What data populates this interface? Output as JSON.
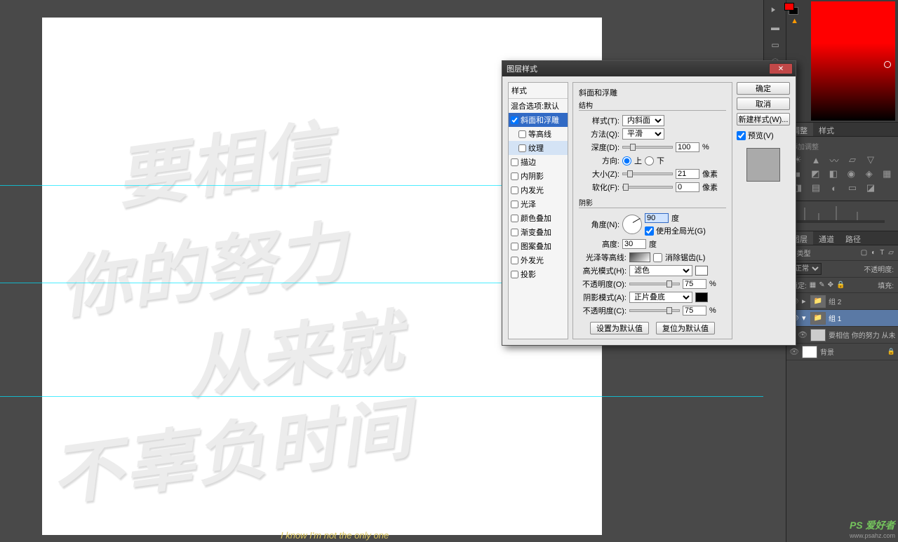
{
  "canvas": {
    "lines": [
      "要相信",
      "你的努力",
      "从来就",
      "不辜负时间"
    ]
  },
  "dialog": {
    "title": "图层样式",
    "styles_header": "样式",
    "blend_defaults": "混合选项:默认",
    "items": {
      "bevel": "斜面和浮雕",
      "contour": "等高线",
      "texture": "纹理",
      "stroke": "描边",
      "inner_shadow": "内阴影",
      "inner_glow": "内发光",
      "satin": "光泽",
      "color_overlay": "颜色叠加",
      "gradient_overlay": "渐变叠加",
      "pattern_overlay": "图案叠加",
      "outer_glow": "外发光",
      "drop_shadow": "投影"
    },
    "section": {
      "title": "斜面和浮雕",
      "structure": "结构",
      "style_label": "样式(T):",
      "style_value": "内斜面",
      "technique_label": "方法(Q):",
      "technique_value": "平滑",
      "depth_label": "深度(D):",
      "depth_value": "100",
      "direction_label": "方向:",
      "dir_up": "上",
      "dir_down": "下",
      "size_label": "大小(Z):",
      "size_value": "21",
      "size_unit": "像素",
      "soften_label": "软化(F):",
      "soften_value": "0",
      "soften_unit": "像素",
      "percent": "%",
      "shading": "阴影",
      "angle_label": "角度(N):",
      "angle_value": "90",
      "angle_unit": "度",
      "global_light": "使用全局光(G)",
      "altitude_label": "高度:",
      "altitude_value": "30",
      "altitude_unit": "度",
      "gloss_label": "光泽等高线:",
      "antialias": "消除锯齿(L)",
      "hl_mode_label": "高光模式(H):",
      "hl_mode_value": "滤色",
      "hl_opacity_label": "不透明度(O):",
      "hl_opacity_value": "75",
      "sh_mode_label": "阴影模式(A):",
      "sh_mode_value": "正片叠底",
      "sh_opacity_label": "不透明度(C):",
      "sh_opacity_value": "75",
      "make_default": "设置为默认值",
      "reset_default": "复位为默认值"
    },
    "buttons": {
      "ok": "确定",
      "cancel": "取消",
      "new_style": "新建样式(W)...",
      "preview": "预览(V)"
    }
  },
  "panels": {
    "adjust_tab": "调整",
    "styles_tab": "样式",
    "adjust_subtitle": "添加调整",
    "layers_tab": "图层",
    "channels_tab": "通道",
    "paths_tab": "路径",
    "filter_kind": "ρ 类型",
    "blend_mode": "正常",
    "opacity_label": "不透明度:",
    "lock_label": "锁定:",
    "fill_label": "填充:",
    "layers": {
      "group2": "组 2",
      "group1": "组 1",
      "text_layer": "要相信 你的努力 从未",
      "background": "背景"
    }
  },
  "subtitle_text": "I know I'm not the only one",
  "watermark": {
    "brand": "PS 爱好者",
    "url": "www.psahz.com"
  }
}
